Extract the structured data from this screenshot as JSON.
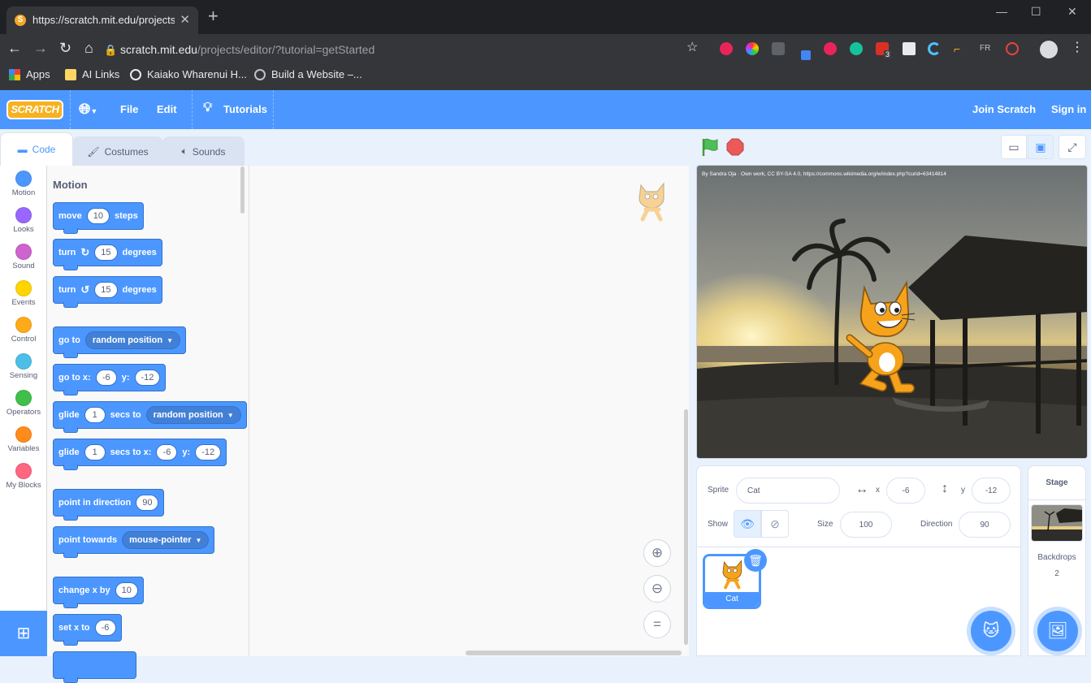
{
  "browser": {
    "tab_title": "https://scratch.mit.edu/projects/e",
    "url_host": "scratch.mit.edu",
    "url_path": "/projects/editor/?tutorial=getStarted",
    "bookmarks": [
      "Apps",
      "AI Links",
      "Kaiako Wharenui H...",
      "Build a Website –..."
    ],
    "extension_badge": "3"
  },
  "menubar": {
    "logo": "SCRATCH",
    "file": "File",
    "edit": "Edit",
    "tutorials": "Tutorials",
    "join": "Join Scratch",
    "signin": "Sign in"
  },
  "editor_tabs": {
    "code": "Code",
    "costumes": "Costumes",
    "sounds": "Sounds"
  },
  "categories": [
    {
      "label": "Motion",
      "color": "#4c97ff"
    },
    {
      "label": "Looks",
      "color": "#9966ff"
    },
    {
      "label": "Sound",
      "color": "#cf63cf"
    },
    {
      "label": "Events",
      "color": "#ffd500"
    },
    {
      "label": "Control",
      "color": "#ffab19"
    },
    {
      "label": "Sensing",
      "color": "#4cbfe6"
    },
    {
      "label": "Operators",
      "color": "#40bf4a"
    },
    {
      "label": "Variables",
      "color": "#ff8c1a"
    },
    {
      "label": "My Blocks",
      "color": "#ff6680"
    }
  ],
  "palette": {
    "title": "Motion",
    "move": {
      "a": "move",
      "n": "10",
      "b": "steps"
    },
    "turn_right": {
      "a": "turn",
      "n": "15",
      "b": "degrees"
    },
    "turn_left": {
      "a": "turn",
      "n": "15",
      "b": "degrees"
    },
    "goto": {
      "a": "go to",
      "dd": "random position"
    },
    "gotoxy": {
      "a": "go to x:",
      "x": "-6",
      "b": "y:",
      "y": "-12"
    },
    "glide_to": {
      "a": "glide",
      "n": "1",
      "b": "secs to",
      "dd": "random position"
    },
    "glide_xy": {
      "a": "glide",
      "n": "1",
      "b": "secs to x:",
      "x": "-6",
      "c": "y:",
      "y": "-12"
    },
    "point_dir": {
      "a": "point in direction",
      "n": "90"
    },
    "point_towards": {
      "a": "point towards",
      "dd": "mouse-pointer"
    },
    "change_x": {
      "a": "change x by",
      "n": "10"
    },
    "set_x": {
      "a": "set x to",
      "n": "-6"
    }
  },
  "stage": {
    "credit": "By Sandra Oja · Own work, CC BY-SA 4.0, https://commons.wikimedia.org/w/index.php?curid=63414814"
  },
  "sprite_info": {
    "sprite_label": "Sprite",
    "sprite_name": "Cat",
    "x_label": "x",
    "x_value": "-6",
    "y_label": "y",
    "y_value": "-12",
    "show_label": "Show",
    "size_label": "Size",
    "size_value": "100",
    "direction_label": "Direction",
    "direction_value": "90",
    "sprite_thumb_label": "Cat"
  },
  "stage_pane": {
    "title": "Stage",
    "backdrops_label": "Backdrops",
    "backdrops_count": "2"
  }
}
